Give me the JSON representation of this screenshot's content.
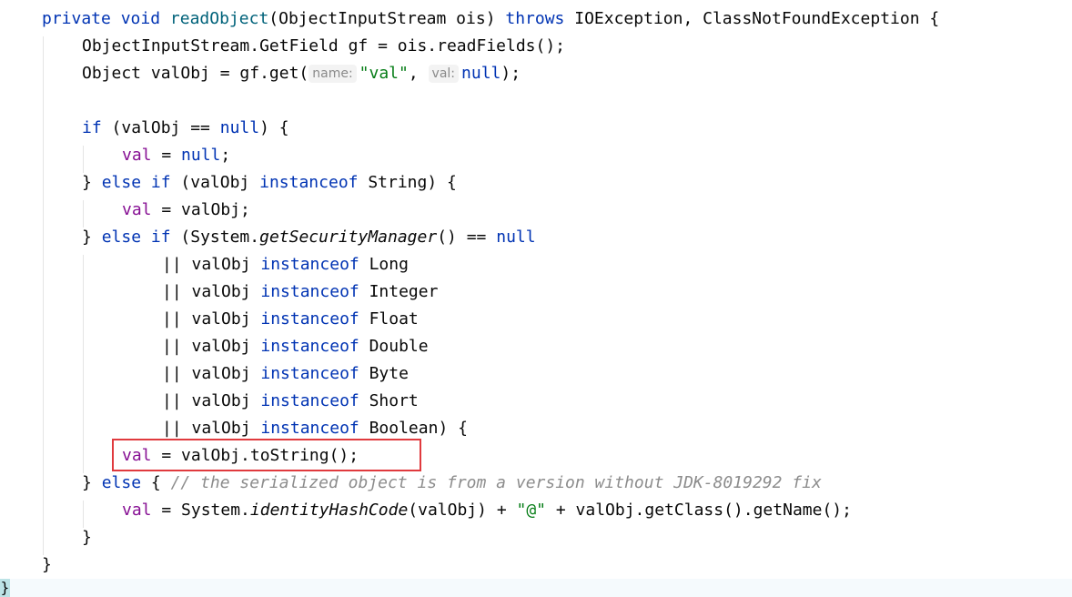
{
  "code": {
    "l1": {
      "private": "private",
      "void": "void",
      "method": "readObject",
      "params": "(ObjectInputStream ois) ",
      "throws": "throws",
      "exceptions": " IOException, ClassNotFoundException {"
    },
    "l2": {
      "text": "ObjectInputStream.GetField gf = ois.readFields();"
    },
    "l3": {
      "start": "Object valObj = gf.get(",
      "hint_name": "name:",
      "str_val": "\"val\"",
      "comma": ", ",
      "hint_val": "val:",
      "null_kw": "null",
      "end": ");"
    },
    "l5": {
      "if_kw": "if",
      "cond": " (valObj == ",
      "null_kw": "null",
      "end": ") {"
    },
    "l6": {
      "field": "val",
      "mid": " = ",
      "null_kw": "null",
      "end": ";"
    },
    "l7": {
      "brace": "} ",
      "else_kw": "else",
      "if_kw": "if",
      "open": " (valObj ",
      "instanceof_kw": "instanceof",
      "end": " String) {"
    },
    "l8": {
      "field": "val",
      "rest": " = valObj;"
    },
    "l9": {
      "brace": "} ",
      "else_kw": "else",
      "if_kw": "if",
      "open": " (System.",
      "call": "getSecurityManager",
      "mid": "() == ",
      "null_kw": "null"
    },
    "or_lines": [
      {
        "prefix": "|| valObj ",
        "instanceof_kw": "instanceof",
        "type": " Long"
      },
      {
        "prefix": "|| valObj ",
        "instanceof_kw": "instanceof",
        "type": " Integer"
      },
      {
        "prefix": "|| valObj ",
        "instanceof_kw": "instanceof",
        "type": " Float"
      },
      {
        "prefix": "|| valObj ",
        "instanceof_kw": "instanceof",
        "type": " Double"
      },
      {
        "prefix": "|| valObj ",
        "instanceof_kw": "instanceof",
        "type": " Byte"
      },
      {
        "prefix": "|| valObj ",
        "instanceof_kw": "instanceof",
        "type": " Short"
      },
      {
        "prefix": "|| valObj ",
        "instanceof_kw": "instanceof",
        "type": " Boolean) {"
      }
    ],
    "l17": {
      "field": "val",
      "rest": " = valObj.toString();"
    },
    "l18": {
      "brace": "} ",
      "else_kw": "else",
      "open": " { ",
      "comment": "// the serialized object is from a version without JDK-8019292 fix"
    },
    "l19": {
      "field": "val",
      "mid": " = System.",
      "call": "identityHashCode",
      "args": "(valObj) + ",
      "str_at": "\"@\"",
      "end": " + valObj.getClass().getName();"
    },
    "l20": {
      "text": "}"
    },
    "l21": {
      "text": "}"
    },
    "l22": {
      "text": "}"
    }
  },
  "colors": {
    "keyword": "#0033b3",
    "method": "#00627a",
    "field": "#871094",
    "string": "#067d17",
    "comment": "#8c8c8c",
    "highlight_border": "#e03a3e"
  }
}
